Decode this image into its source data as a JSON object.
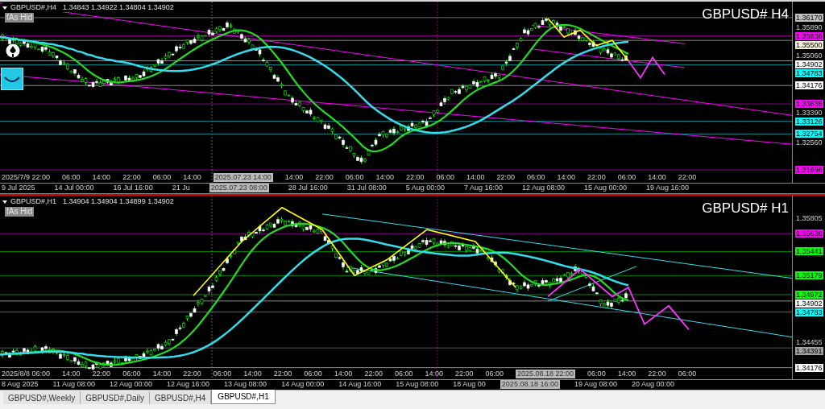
{
  "charts": [
    {
      "symbol_period": "GBPUSD#,H4",
      "ohlc": "1.34843 1.34922 1.34804 1.34902",
      "title": "GBPUSD# H4",
      "hide_button": "fAs Hid",
      "drawing_tools": true,
      "active": false,
      "price_labels": [
        {
          "text": "1.36170",
          "kind": "marker",
          "color": "#c0c0c0"
        },
        {
          "text": "1.35890",
          "kind": "tick"
        },
        {
          "text": "1.35636",
          "kind": "marker",
          "color": "#ff00ff"
        },
        {
          "text": "1.35500",
          "kind": "marker",
          "color": "#f5f0dc"
        },
        {
          "text": "1.35060",
          "kind": "tick"
        },
        {
          "text": "1.34902",
          "kind": "marker",
          "color": "#ffffff"
        },
        {
          "text": "1.34783",
          "kind": "marker",
          "color": "#00ffff"
        },
        {
          "text": "1.34176",
          "kind": "marker",
          "color": "#ffffff"
        },
        {
          "text": "1.33635",
          "kind": "marker",
          "color": "#ff00ff"
        },
        {
          "text": "1.33390",
          "kind": "tick"
        },
        {
          "text": "1.33126",
          "kind": "marker",
          "color": "#00ffff"
        },
        {
          "text": "1.32754",
          "kind": "marker",
          "color": "#00ffff"
        },
        {
          "text": "1.32560",
          "kind": "tick"
        },
        {
          "text": "1.31696",
          "kind": "marker",
          "color": "#ff00ff"
        }
      ],
      "time_labels_upper": [
        {
          "text": "2025/7/9 22:00",
          "highlighted": false
        },
        {
          "text": "06:00",
          "highlighted": false
        },
        {
          "text": "14:00",
          "highlighted": false
        },
        {
          "text": "22:00",
          "highlighted": false
        },
        {
          "text": "06:00",
          "highlighted": false
        },
        {
          "text": "14:00",
          "highlighted": false
        },
        {
          "text": "2025.07.23 14:00",
          "highlighted": true
        },
        {
          "text": "14:00",
          "highlighted": false
        },
        {
          "text": "22:00",
          "highlighted": false
        },
        {
          "text": "06:00",
          "highlighted": false
        },
        {
          "text": "14:00",
          "highlighted": false
        },
        {
          "text": "22:00",
          "highlighted": false
        },
        {
          "text": "06:00",
          "highlighted": false
        },
        {
          "text": "14:00",
          "highlighted": false
        },
        {
          "text": "22:00",
          "highlighted": false
        },
        {
          "text": "06:00",
          "highlighted": false
        },
        {
          "text": "14:00",
          "highlighted": false
        },
        {
          "text": "22:00",
          "highlighted": false
        },
        {
          "text": "06:00",
          "highlighted": false
        },
        {
          "text": "14:00",
          "highlighted": false
        },
        {
          "text": "22:00",
          "highlighted": false
        }
      ],
      "time_labels_lower": [
        {
          "text": "9 Jul 2025",
          "highlighted": false
        },
        {
          "text": "14 Jul 00:00",
          "highlighted": false
        },
        {
          "text": "16 Jul 16:00",
          "highlighted": false
        },
        {
          "text": "21 Ju",
          "highlighted": false
        },
        {
          "text": "2025.07.23 08:00",
          "highlighted": true
        },
        {
          "text": "28 Jul 16:00",
          "highlighted": false
        },
        {
          "text": "31 Jul 08:00",
          "highlighted": false
        },
        {
          "text": "5 Aug 00:00",
          "highlighted": false
        },
        {
          "text": "7 Aug 16:00",
          "highlighted": false
        },
        {
          "text": "12 Aug 08:00",
          "highlighted": false
        },
        {
          "text": "15 Aug 00:00",
          "highlighted": false
        },
        {
          "text": "19 Aug 16:00",
          "highlighted": false
        }
      ]
    },
    {
      "symbol_period": "GBPUSD#,H1",
      "ohlc": "1.34904 1.34904 1.34899 1.34902",
      "title": "GBPUSD# H1",
      "hide_button": "fAs Hid",
      "drawing_tools": false,
      "active": true,
      "price_labels": [
        {
          "text": "1.35805",
          "kind": "tick"
        },
        {
          "text": "1.35636",
          "kind": "marker",
          "color": "#ff00ff"
        },
        {
          "text": "1.35441",
          "kind": "marker",
          "color": "#00ff00"
        },
        {
          "text": "1.35179",
          "kind": "marker",
          "color": "#00ff00"
        },
        {
          "text": "1.34972",
          "kind": "marker",
          "color": "#00ff00"
        },
        {
          "text": "1.34902",
          "kind": "marker",
          "color": "#ffffff"
        },
        {
          "text": "1.34783",
          "kind": "marker",
          "color": "#00ffff"
        },
        {
          "text": "1.34455",
          "kind": "tick"
        },
        {
          "text": "1.34391",
          "kind": "marker",
          "color": "#a0a0a0"
        },
        {
          "text": "1.34176",
          "kind": "marker",
          "color": "#ffffff"
        }
      ],
      "time_labels_upper": [
        {
          "text": "2025/8/8 06:00",
          "highlighted": false
        },
        {
          "text": "14:00",
          "highlighted": false
        },
        {
          "text": "22:00",
          "highlighted": false
        },
        {
          "text": "06:00",
          "highlighted": false
        },
        {
          "text": "14:00",
          "highlighted": false
        },
        {
          "text": "22:00",
          "highlighted": false
        },
        {
          "text": "06:00",
          "highlighted": false
        },
        {
          "text": "14:00",
          "highlighted": false
        },
        {
          "text": "22:00",
          "highlighted": false
        },
        {
          "text": "06:00",
          "highlighted": false
        },
        {
          "text": "14:00",
          "highlighted": false
        },
        {
          "text": "22:00",
          "highlighted": false
        },
        {
          "text": "06:00",
          "highlighted": false
        },
        {
          "text": "14:00",
          "highlighted": false
        },
        {
          "text": "22:00",
          "highlighted": false
        },
        {
          "text": "06:00",
          "highlighted": false
        },
        {
          "text": "2025.08.18 22:00",
          "highlighted": true
        },
        {
          "text": "06:00",
          "highlighted": false
        },
        {
          "text": "14:00",
          "highlighted": false
        },
        {
          "text": "22:00",
          "highlighted": false
        },
        {
          "text": "06:00",
          "highlighted": false
        }
      ],
      "time_labels_lower": [
        {
          "text": "8 Aug 2025",
          "highlighted": false
        },
        {
          "text": "11 Aug 08:00",
          "highlighted": false
        },
        {
          "text": "12 Aug 00:00",
          "highlighted": false
        },
        {
          "text": "12 Aug 16:00",
          "highlighted": false
        },
        {
          "text": "13 Aug 08:00",
          "highlighted": false
        },
        {
          "text": "14 Aug 00:00",
          "highlighted": false
        },
        {
          "text": "14 Aug 16:00",
          "highlighted": false
        },
        {
          "text": "15 Aug 08:00",
          "highlighted": false
        },
        {
          "text": "18 Aug 00",
          "highlighted": false
        },
        {
          "text": "2025.08.18 16:00",
          "highlighted": true
        },
        {
          "text": "19 Aug 08:00",
          "highlighted": false
        },
        {
          "text": "20 Aug 00:00",
          "highlighted": false
        }
      ]
    }
  ],
  "tabs": [
    {
      "label": "GBPUSD#,Weekly",
      "selected": false
    },
    {
      "label": "GBPUSD#,Daily",
      "selected": false
    },
    {
      "label": "GBPUSD#,H4",
      "selected": false
    },
    {
      "label": "GBPUSD#,H1",
      "selected": true
    }
  ]
}
